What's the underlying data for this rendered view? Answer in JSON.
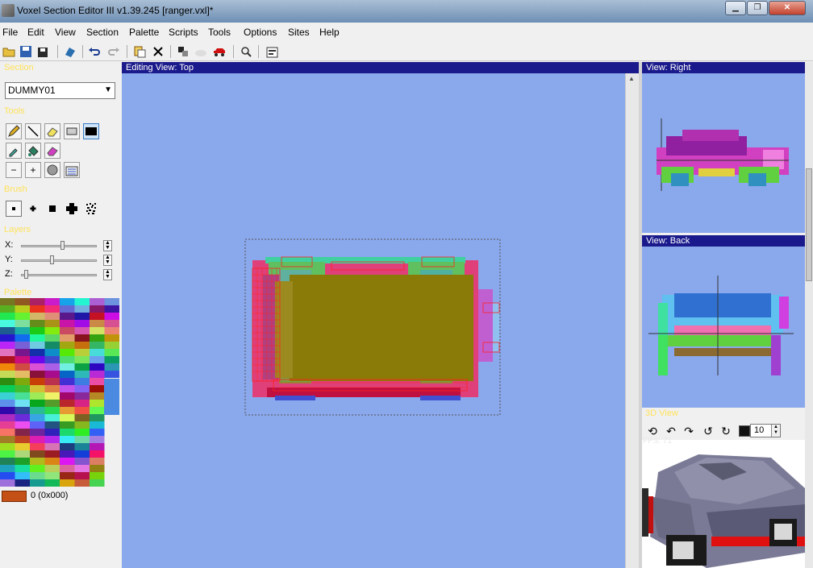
{
  "window": {
    "title": "Voxel Section Editor III v1.39.245 [ranger.vxl]*",
    "minimize_glyph": "▁",
    "maximize_glyph": "❐",
    "close_glyph": "✕"
  },
  "menu": [
    "File",
    "Edit",
    "View",
    "Section",
    "Palette",
    "Scripts",
    "Tools",
    "Options",
    "Sites",
    "Help"
  ],
  "toolbar": {
    "icons": [
      "open-icon",
      "save-icon",
      "save-as-icon",
      "preview-icon",
      "undo-icon",
      "redo-icon",
      "paste-icon",
      "clear-icon",
      "copy-section-icon",
      "mirror-icon",
      "vehicle-icon",
      "search-icon",
      "properties-icon"
    ]
  },
  "left_panel": {
    "section_label": "Section",
    "section_value": "DUMMY01",
    "tools_label": "Tools",
    "brush_label": "Brush",
    "layers_label": "Layers",
    "layer_x_label": "X:",
    "layer_y_label": "Y:",
    "layer_z_label": "Z:",
    "layer_x_value": 0.55,
    "layer_y_value": 0.4,
    "layer_z_value": 0.05,
    "palette_label": "Palette",
    "selected_color_value": "0 (0x000)",
    "selected_color_hex": "#c45018"
  },
  "editing_view": {
    "title": "Editing View:  Top"
  },
  "right_panes": {
    "right_title": "View:  Right",
    "back_title": "View:  Back",
    "view3d_label": "3D View",
    "zoom_value": "10",
    "fps_text": "FPS: 71"
  },
  "colors": {
    "canvas_bg": "#8aa8ec",
    "view_header": "#1a1a8c",
    "panel_label": "#ffe25a"
  }
}
